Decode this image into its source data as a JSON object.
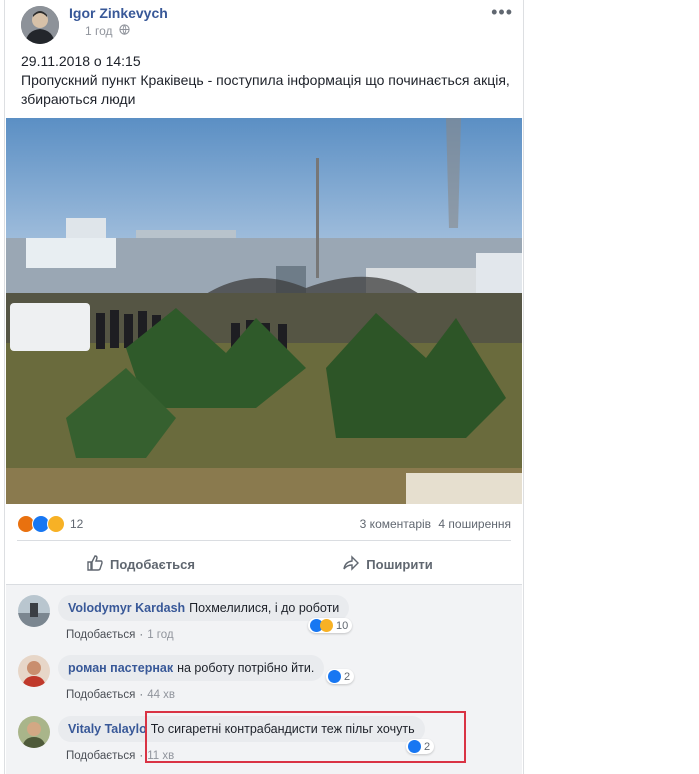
{
  "post": {
    "author": "Igor Zinkevych",
    "time": "1 год",
    "more_icon": "more-dots-icon",
    "text_line1": "29.11.2018 о 14:15",
    "text_line2": "Пропускний пункт Краківець - поступила інформація що починається акція, збираються люди",
    "reactions_count": "12",
    "comments_count": "3 коментарів",
    "shares_count": "4 поширення",
    "like_label": "Подобається",
    "share_label": "Поширити"
  },
  "comments": [
    {
      "name": "Volodymyr Kardash",
      "text": "Похмелилися, і до роботи",
      "like": "Подобається",
      "time": "1 год",
      "likes": "10"
    },
    {
      "name": "роман пастернак",
      "text": "на роботу потрібно йти.",
      "like": "Подобається",
      "time": "44 хв",
      "likes": "2"
    },
    {
      "name": "Vitaly Talaylo",
      "text": "То сигаретні контрабандисти теж пільг хочуть",
      "like": "Подобається",
      "time": "11 хв",
      "likes": "2"
    }
  ],
  "colors": {
    "link": "#385898",
    "highlight": "#d93344",
    "like_blue": "#1877f2"
  }
}
